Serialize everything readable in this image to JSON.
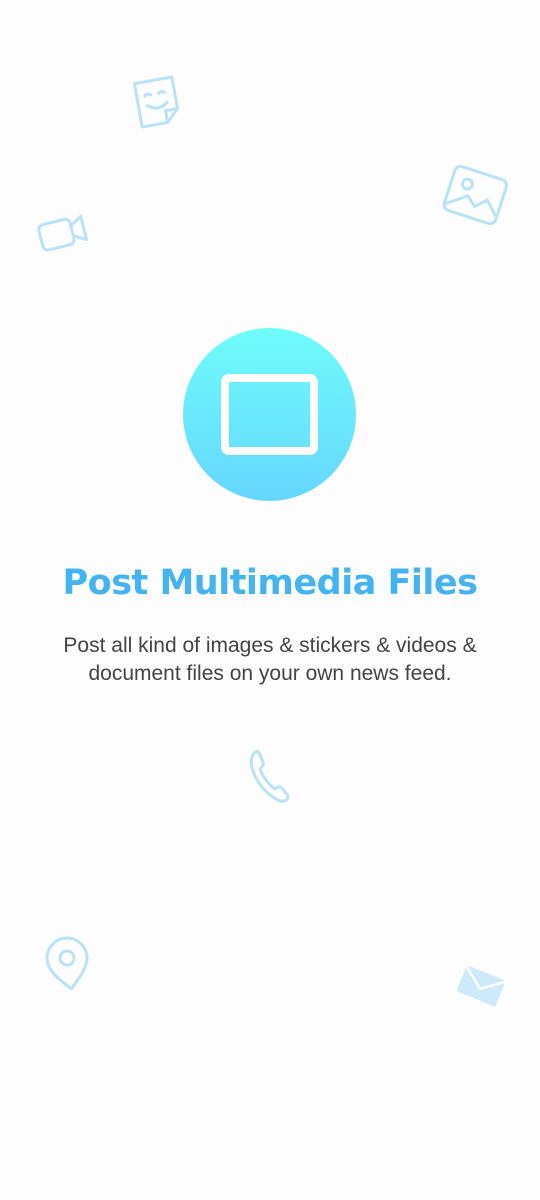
{
  "onboarding": {
    "title": "Post Multimedia Files",
    "description": "Post all kind of images & stickers & videos & document files on your own news feed."
  },
  "icons": {
    "hero": "image-frame-icon",
    "decorations": [
      "sticker-icon",
      "image-icon",
      "video-camera-icon",
      "phone-icon",
      "location-pin-icon",
      "envelope-icon"
    ]
  },
  "colors": {
    "title": "#43b3f2",
    "description": "#444444",
    "hero_gradient_top": "#6ffcfb",
    "hero_gradient_bottom": "#66d6fd",
    "decoration": "#b9e2f8",
    "background": "#fdfdfd"
  }
}
